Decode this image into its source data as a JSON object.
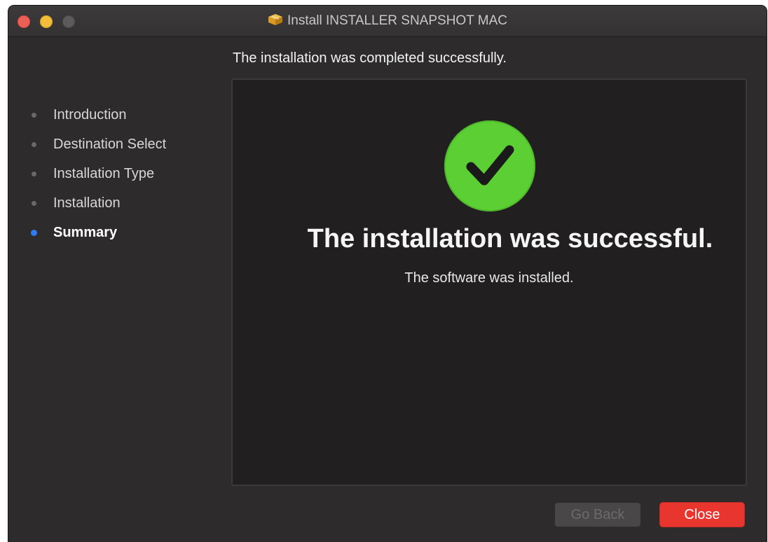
{
  "window": {
    "title": "Install INSTALLER SNAPSHOT MAC",
    "title_icon": "package-icon",
    "controls": [
      "close",
      "minimize",
      "zoom"
    ]
  },
  "heading": "The installation was completed successfully.",
  "sidebar": {
    "items": [
      {
        "label": "Introduction",
        "state": "done"
      },
      {
        "label": "Destination Select",
        "state": "done"
      },
      {
        "label": "Installation Type",
        "state": "done"
      },
      {
        "label": "Installation",
        "state": "done"
      },
      {
        "label": "Summary",
        "state": "active"
      }
    ]
  },
  "main": {
    "status_icon": "checkmark-icon",
    "title": "The installation was successful.",
    "subtitle": "The software was installed."
  },
  "footer": {
    "back_label": "Go Back",
    "close_label": "Close"
  },
  "colors": {
    "accent": "#2f7bf6",
    "success": "#5ccf34",
    "close_button": "#e8362e",
    "background": "#2e2b2c"
  }
}
